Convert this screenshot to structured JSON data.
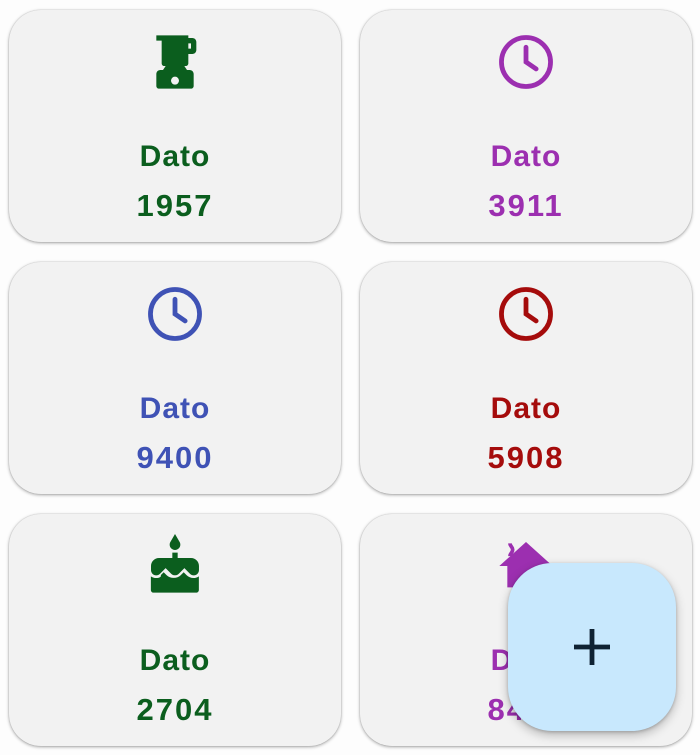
{
  "cards": [
    {
      "label": "Dato",
      "value": "1957",
      "icon": "blender-icon",
      "color": "#0b5e1e"
    },
    {
      "label": "Dato",
      "value": "3911",
      "icon": "clock-icon",
      "color": "#9c2fb0"
    },
    {
      "label": "Dato",
      "value": "9400",
      "icon": "clock-icon",
      "color": "#3f52b5"
    },
    {
      "label": "Dato",
      "value": "5908",
      "icon": "clock-icon",
      "color": "#a50c0c"
    },
    {
      "label": "Dato",
      "value": "2704",
      "icon": "cake-icon",
      "color": "#0b5e1e"
    },
    {
      "label": "Dato",
      "value": "8415",
      "icon": "home-icon",
      "color": "#9c2fb0"
    }
  ],
  "fab": {
    "icon": "plus-icon",
    "background": "#c8e8fd"
  }
}
